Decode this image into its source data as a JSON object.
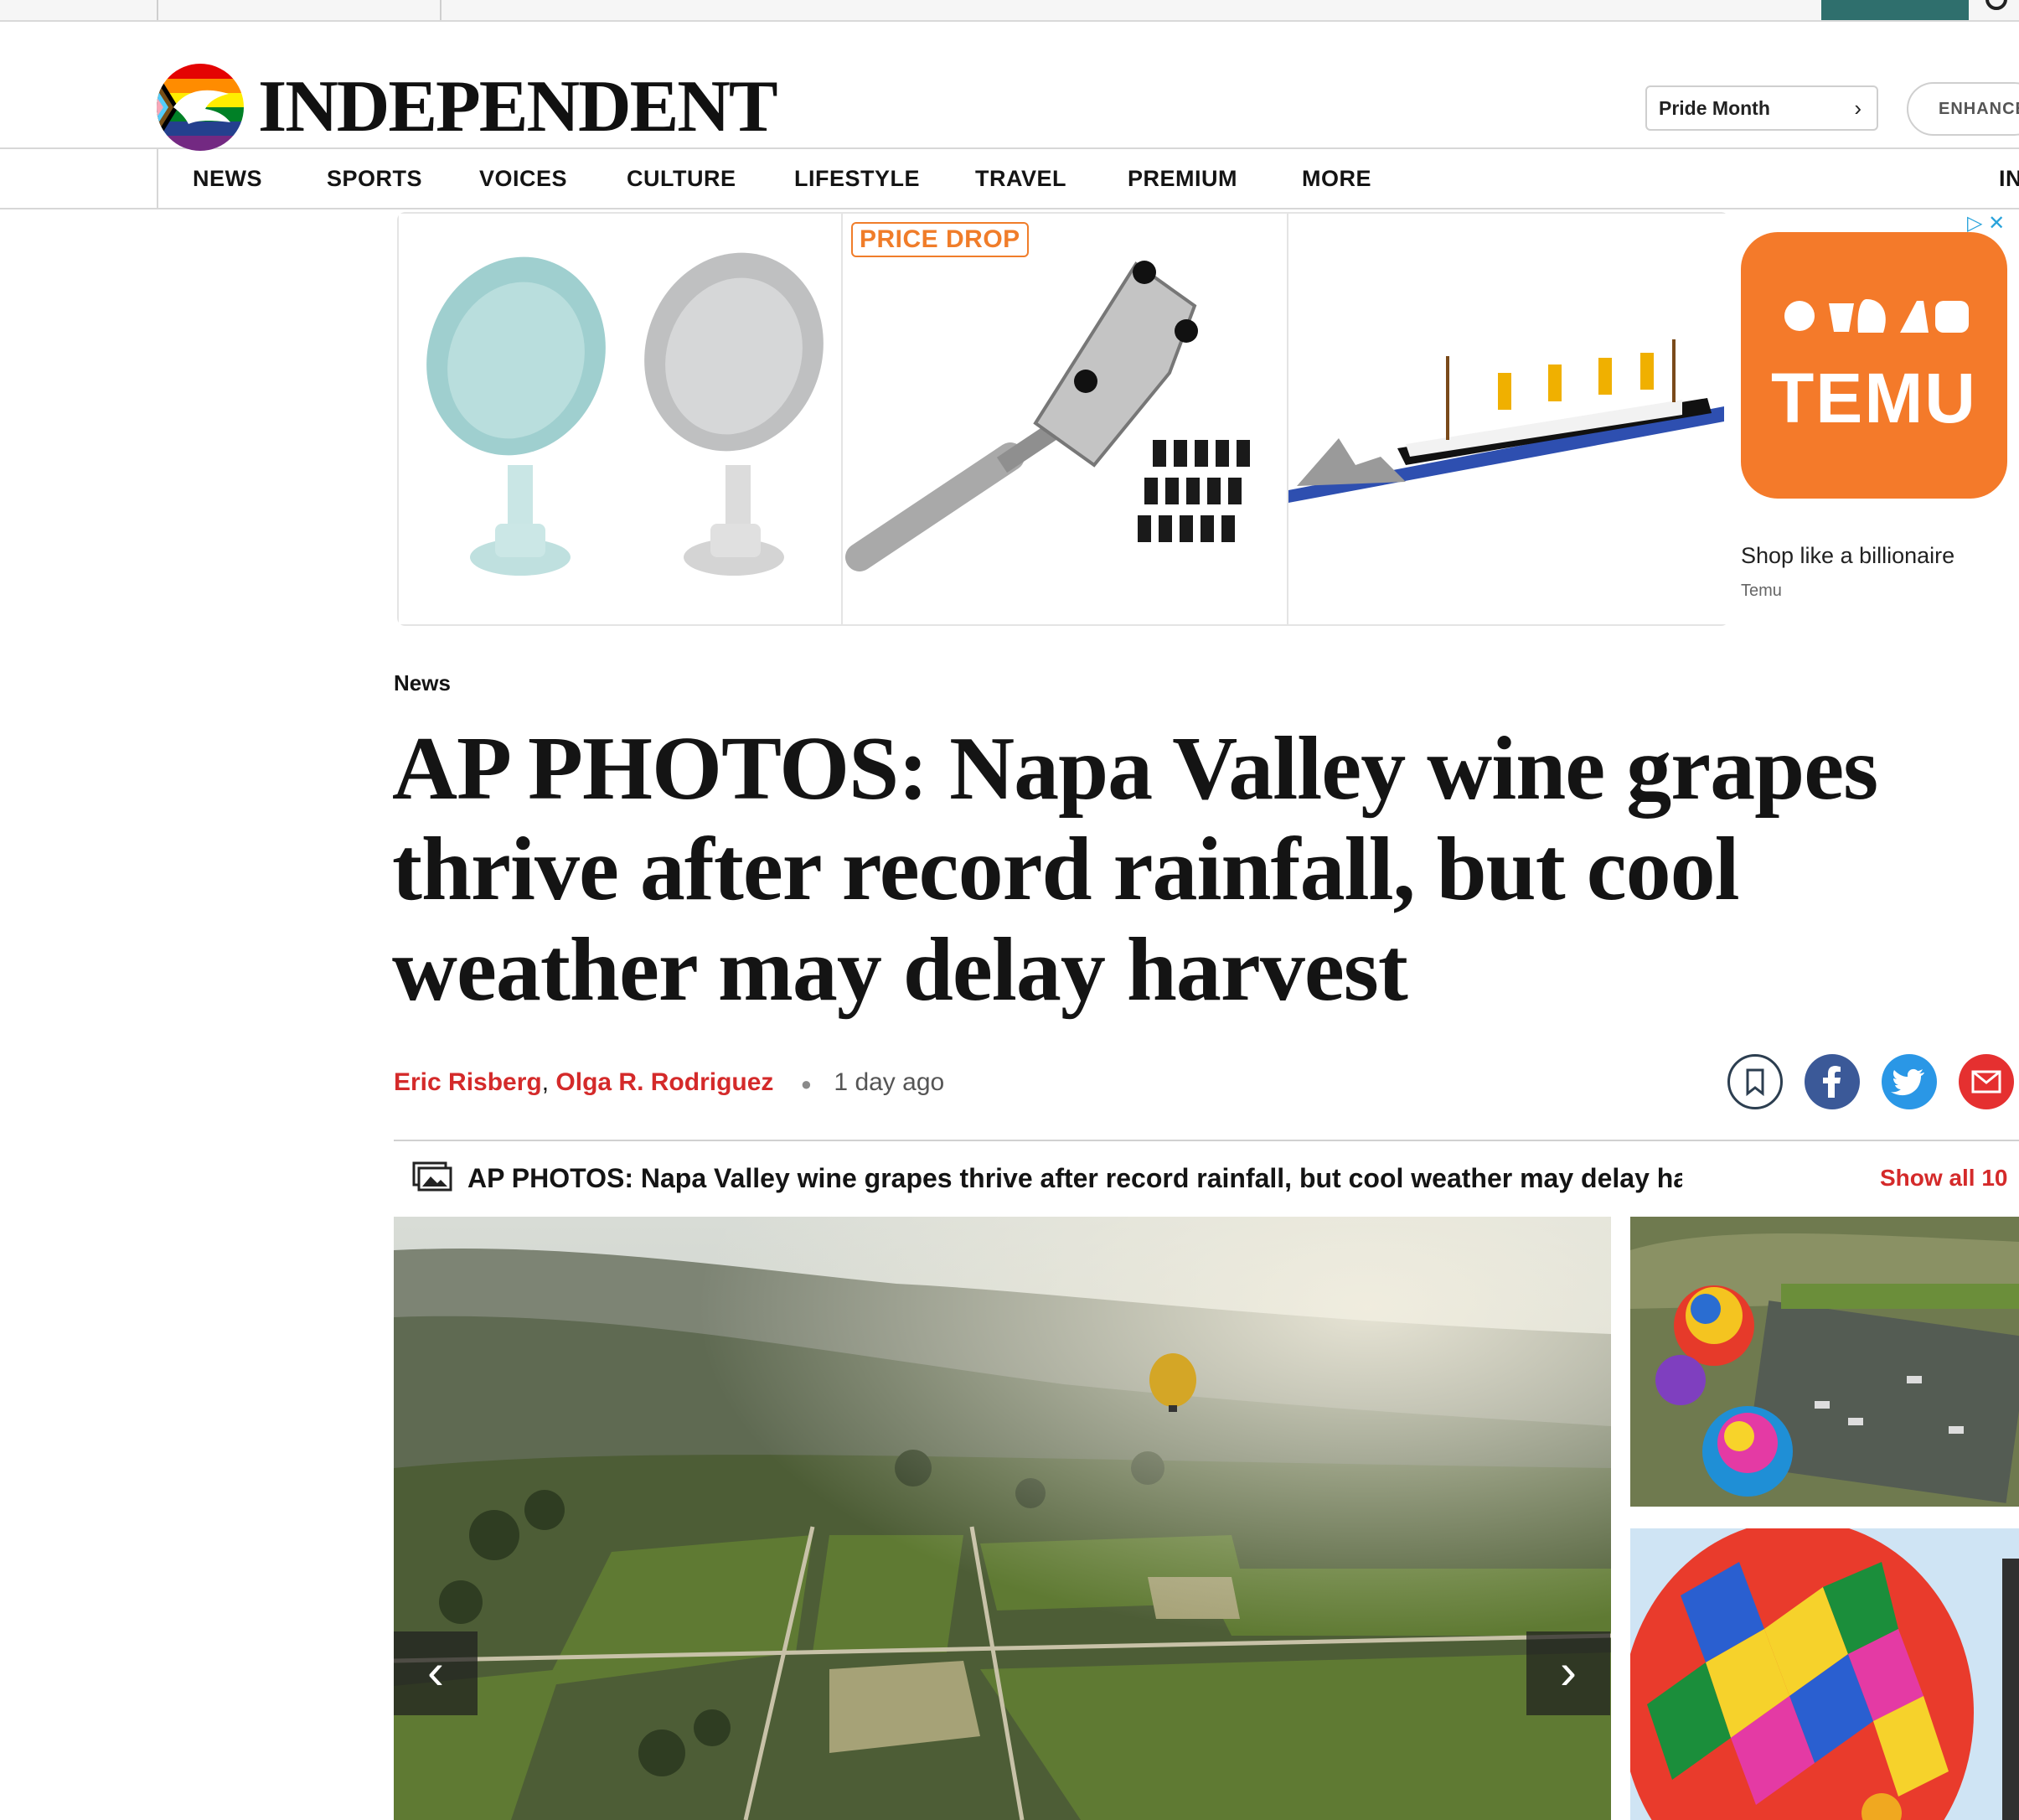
{
  "site": {
    "name": "INDEPENDENT",
    "pride_link": "Pride Month",
    "enhance_label": "ENHANCED",
    "nav_overflow": "IN"
  },
  "nav": {
    "items": [
      "NEWS",
      "SPORTS",
      "VOICES",
      "CULTURE",
      "LIFESTYLE",
      "TRAVEL",
      "PREMIUM",
      "MORE"
    ]
  },
  "ad": {
    "badge": "PRICE DROP",
    "brand": "TEMU",
    "tagline": "Shop like a billionaire",
    "advertiser": "Temu",
    "products": [
      "soap-dish-holders",
      "watch-case-opener-tool",
      "titanic-block-model"
    ],
    "accent_color": "#f47a2a"
  },
  "article": {
    "section": "News",
    "headline": "AP PHOTOS: Napa Valley wine grapes thrive after record rainfall, but cool weather may delay harvest",
    "authors": [
      "Eric Risberg",
      "Olga R. Rodriguez"
    ],
    "author_separator": ",",
    "published": "1 day ago"
  },
  "share": [
    "bookmark-icon",
    "facebook-icon",
    "twitter-icon",
    "email-icon"
  ],
  "gallery": {
    "title": "AP PHOTOS: Napa Valley wine grapes thrive after record rainfall, but cool weather may delay harvest",
    "show_all": "Show all 10",
    "prev_label": "‹",
    "next_label": "›"
  },
  "colors": {
    "link_red": "#d42a2a",
    "facebook": "#3b5998",
    "twitter": "#2a97e6",
    "email": "#e53030"
  }
}
